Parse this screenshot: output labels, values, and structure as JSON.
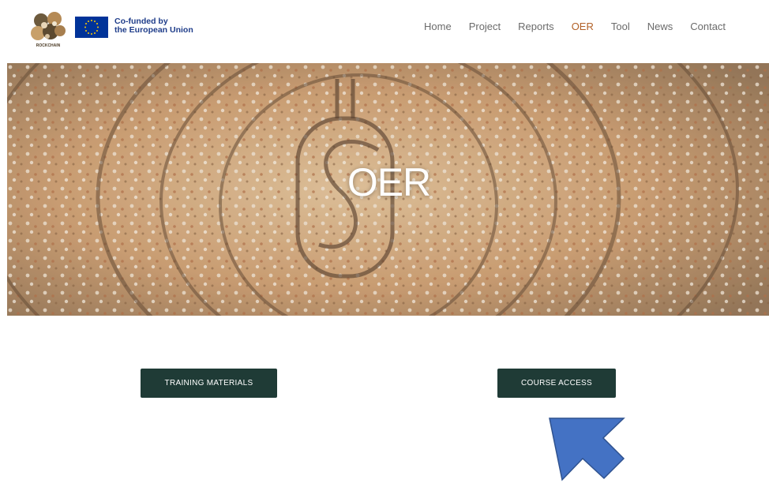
{
  "header": {
    "logo_text": "ROCKCHAIN",
    "eu_line1": "Co-funded by",
    "eu_line2": "the European Union",
    "nav": [
      {
        "label": "Home",
        "active": false
      },
      {
        "label": "Project",
        "active": false
      },
      {
        "label": "Reports",
        "active": false
      },
      {
        "label": "OER",
        "active": true
      },
      {
        "label": "Tool",
        "active": false
      },
      {
        "label": "News",
        "active": false
      },
      {
        "label": "Contact",
        "active": false
      }
    ]
  },
  "hero": {
    "title": "OER"
  },
  "buttons": {
    "training": "TRAINING MATERIALS",
    "course": "COURSE ACCESS"
  },
  "colors": {
    "accent": "#b26127",
    "button_bg": "#1f3b36",
    "arrow": "#4472c4",
    "eu_blue": "#003399"
  },
  "icons": [
    "rockchain-logo",
    "eu-flag-icon",
    "pointer-arrow-icon"
  ]
}
